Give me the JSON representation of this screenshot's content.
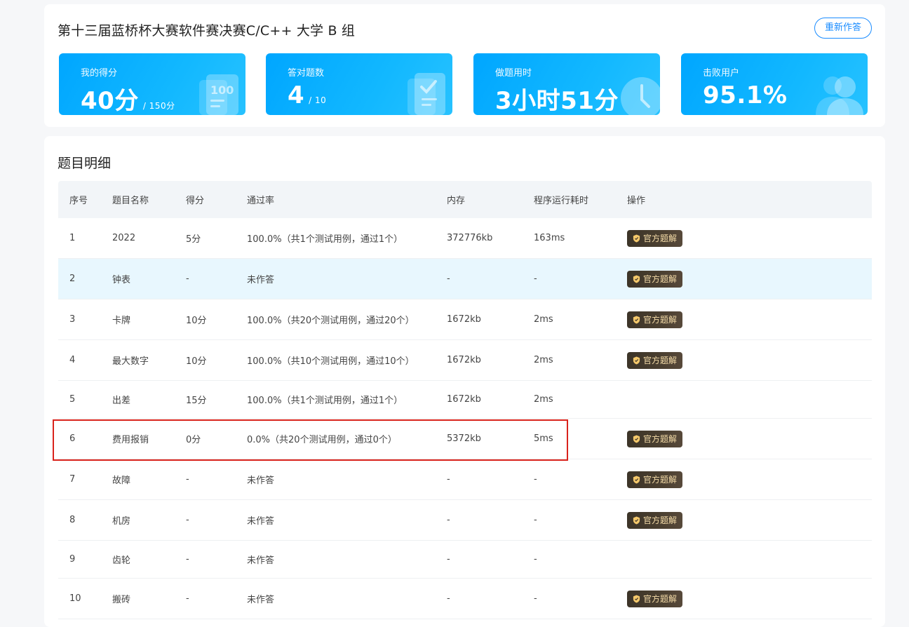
{
  "header": {
    "title": "第十三届蓝桥杯大赛软件赛决赛C/C++ 大学 B 组",
    "redo_label": "重新作答"
  },
  "stats": [
    {
      "label": "我的得分",
      "value": "40分",
      "suffix": "/ 150分",
      "icon": "score-sheet-icon"
    },
    {
      "label": "答对题数",
      "value": "4",
      "suffix": "/ 10",
      "icon": "checklist-icon"
    },
    {
      "label": "做题用时",
      "value": "3小时51分",
      "suffix": "",
      "icon": "clock-icon"
    },
    {
      "label": "击败用户",
      "value": "95.1%",
      "suffix": "",
      "icon": "users-icon"
    }
  ],
  "detail": {
    "title": "题目明细",
    "columns": [
      "序号",
      "题目名称",
      "得分",
      "通过率",
      "内存",
      "程序运行耗时",
      "操作"
    ],
    "solution_label": "官方题解",
    "rows": [
      {
        "no": "1",
        "name": "2022",
        "score": "5分",
        "rate": "100.0%（共1个测试用例，通过1个）",
        "mem": "372776kb",
        "time": "163ms",
        "has_solution": true
      },
      {
        "no": "2",
        "name": "钟表",
        "score": "-",
        "rate": "未作答",
        "mem": "-",
        "time": "-",
        "has_solution": true
      },
      {
        "no": "3",
        "name": "卡牌",
        "score": "10分",
        "rate": "100.0%（共20个测试用例，通过20个）",
        "mem": "1672kb",
        "time": "2ms",
        "has_solution": true
      },
      {
        "no": "4",
        "name": "最大数字",
        "score": "10分",
        "rate": "100.0%（共10个测试用例，通过10个）",
        "mem": "1672kb",
        "time": "2ms",
        "has_solution": true
      },
      {
        "no": "5",
        "name": "出差",
        "score": "15分",
        "rate": "100.0%（共1个测试用例，通过1个）",
        "mem": "1672kb",
        "time": "2ms",
        "has_solution": false
      },
      {
        "no": "6",
        "name": "费用报销",
        "score": "0分",
        "rate": "0.0%（共20个测试用例，通过0个）",
        "mem": "5372kb",
        "time": "5ms",
        "has_solution": true
      },
      {
        "no": "7",
        "name": "故障",
        "score": "-",
        "rate": "未作答",
        "mem": "-",
        "time": "-",
        "has_solution": true
      },
      {
        "no": "8",
        "name": "机房",
        "score": "-",
        "rate": "未作答",
        "mem": "-",
        "time": "-",
        "has_solution": true
      },
      {
        "no": "9",
        "name": "齿轮",
        "score": "-",
        "rate": "未作答",
        "mem": "-",
        "time": "-",
        "has_solution": false
      },
      {
        "no": "10",
        "name": "搬砖",
        "score": "-",
        "rate": "未作答",
        "mem": "-",
        "time": "-",
        "has_solution": true
      }
    ]
  },
  "colors": {
    "accent": "#1a8cff",
    "stat_bg": "#12b8ff",
    "highlight_row": "#e8f7fe",
    "annotation": "#d9231c"
  }
}
